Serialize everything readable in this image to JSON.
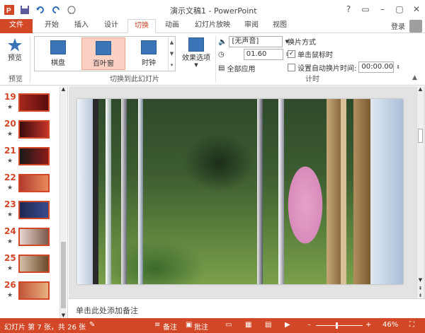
{
  "window": {
    "title": "演示文稿1 - PowerPoint"
  },
  "tabs": [
    "文件",
    "开始",
    "插入",
    "设计",
    "切换",
    "动画",
    "幻灯片放映",
    "审阅",
    "视图"
  ],
  "account": {
    "login": "登录"
  },
  "ribbon": {
    "preview": {
      "label": "预览",
      "group": "预览"
    },
    "transitions": {
      "items": [
        "棋盘",
        "百叶窗",
        "时钟"
      ],
      "selected": "百叶窗",
      "effect_options": "效果选项",
      "group": "切换到此幻灯片"
    },
    "timing": {
      "sound": "[无声音]",
      "duration": "01.60",
      "apply_all": "全部应用",
      "advance_title": "换片方式",
      "on_click": "单击鼠标时",
      "on_click_checked": true,
      "after_time": "设置自动换片时间:",
      "after_time_checked": false,
      "after_value": "00:00.00",
      "group": "计时"
    }
  },
  "slides": [
    {
      "num": "19",
      "star": "★"
    },
    {
      "num": "20",
      "star": "★"
    },
    {
      "num": "21",
      "star": "★"
    },
    {
      "num": "22",
      "star": "★"
    },
    {
      "num": "23",
      "star": "★"
    },
    {
      "num": "24",
      "star": "★"
    },
    {
      "num": "25",
      "star": "★"
    },
    {
      "num": "26",
      "star": "★"
    }
  ],
  "notes": {
    "placeholder": "单击此处添加备注"
  },
  "status": {
    "slide_info": "幻灯片 第 7 张，共 26 张",
    "notes": "备注",
    "comments": "批注",
    "zoom": "46%"
  },
  "colors": {
    "accent": "#d24726",
    "statusbar": "#d24726"
  }
}
